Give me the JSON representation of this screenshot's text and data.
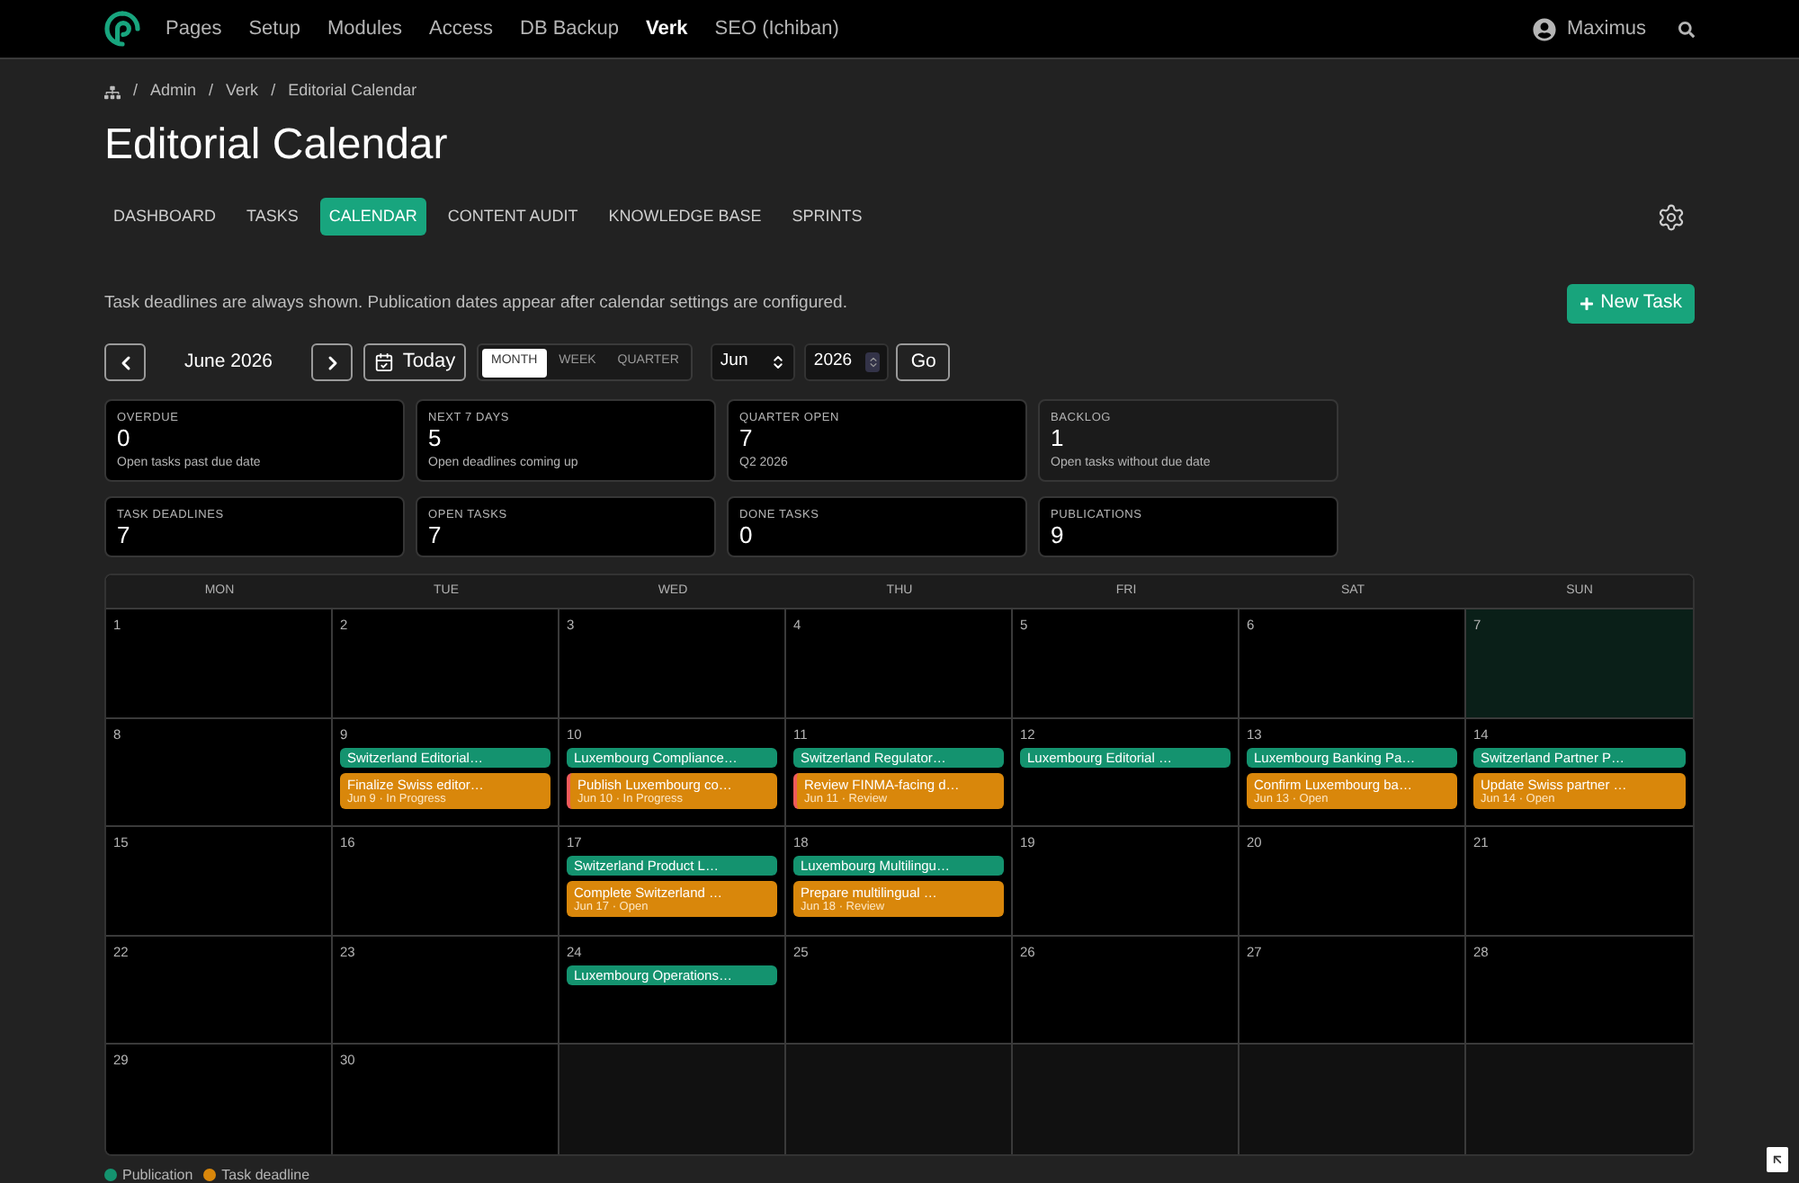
{
  "nav": {
    "links": [
      {
        "label": "Pages",
        "selected": false
      },
      {
        "label": "Setup",
        "selected": false
      },
      {
        "label": "Modules",
        "selected": false
      },
      {
        "label": "Access",
        "selected": false
      },
      {
        "label": "DB Backup",
        "selected": false
      },
      {
        "label": "Verk",
        "selected": true
      },
      {
        "label": "SEO (Ichiban)",
        "selected": false
      }
    ],
    "user": "Maximus"
  },
  "breadcrumb": [
    {
      "separator": "/",
      "label": "Admin"
    },
    {
      "separator": "/",
      "label": "Verk"
    },
    {
      "separator": "/",
      "label": "Editorial Calendar"
    }
  ],
  "title": "Editorial Calendar",
  "tabs": [
    {
      "label": "DASHBOARD",
      "selected": false
    },
    {
      "label": "TASKS",
      "selected": false
    },
    {
      "label": "CALENDAR",
      "selected": true
    },
    {
      "label": "CONTENT AUDIT",
      "selected": false
    },
    {
      "label": "KNOWLEDGE BASE",
      "selected": false
    },
    {
      "label": "SPRINTS",
      "selected": false
    }
  ],
  "info": "Task deadlines are always shown. Publication dates appear after calendar settings are configured.",
  "new_task_button": "New Task",
  "controls": {
    "period": "June 2026",
    "today_button": "Today",
    "views": [
      {
        "label": "MONTH",
        "selected": true
      },
      {
        "label": "WEEK",
        "selected": false
      },
      {
        "label": "QUARTER",
        "selected": false
      }
    ],
    "month_select": "Jun",
    "year_input": "2026",
    "go_button": "Go"
  },
  "stats": [
    {
      "label": "OVERDUE",
      "value": "0",
      "note": "Open tasks past due date",
      "muted": false
    },
    {
      "label": "NEXT 7 DAYS",
      "value": "5",
      "note": "Open deadlines coming up",
      "muted": false
    },
    {
      "label": "QUARTER OPEN",
      "value": "7",
      "note": "Q2 2026",
      "muted": false
    },
    {
      "label": "BACKLOG",
      "value": "1",
      "note": "Open tasks without due date",
      "muted": true
    },
    {
      "label": "TASK DEADLINES",
      "value": "7",
      "muted": false
    },
    {
      "label": "OPEN TASKS",
      "value": "7",
      "muted": false
    },
    {
      "label": "DONE TASKS",
      "value": "0",
      "muted": false
    },
    {
      "label": "PUBLICATIONS",
      "value": "9",
      "muted": false
    }
  ],
  "calendar": {
    "weekdays": [
      "MON",
      "TUE",
      "WED",
      "THU",
      "FRI",
      "SAT",
      "SUN"
    ],
    "weeks": [
      [
        {
          "day": "1",
          "in_month": true,
          "today": false
        },
        {
          "day": "2",
          "in_month": true,
          "today": false
        },
        {
          "day": "3",
          "in_month": true,
          "today": false
        },
        {
          "day": "4",
          "in_month": true,
          "today": false
        },
        {
          "day": "5",
          "in_month": true,
          "today": false
        },
        {
          "day": "6",
          "in_month": true,
          "today": false
        },
        {
          "day": "7",
          "in_month": true,
          "today": true
        }
      ],
      [
        {
          "day": "8",
          "in_month": true,
          "today": false
        },
        {
          "day": "9",
          "in_month": true,
          "today": false,
          "events": [
            {
              "kind": "publication",
              "title": "Switzerland Editorial…"
            },
            {
              "kind": "task",
              "title": "Finalize Swiss editor…",
              "meta": "Jun 9 · In Progress",
              "flagged": false
            }
          ]
        },
        {
          "day": "10",
          "in_month": true,
          "today": false,
          "events": [
            {
              "kind": "publication",
              "title": "Luxembourg Compliance…"
            },
            {
              "kind": "task",
              "title": "Publish Luxembourg co…",
              "meta": "Jun 10 · In Progress",
              "flagged": true
            }
          ]
        },
        {
          "day": "11",
          "in_month": true,
          "today": false,
          "events": [
            {
              "kind": "publication",
              "title": "Switzerland Regulator…"
            },
            {
              "kind": "task",
              "title": "Review FINMA-facing d…",
              "meta": "Jun 11 · Review",
              "flagged": true
            }
          ]
        },
        {
          "day": "12",
          "in_month": true,
          "today": false,
          "events": [
            {
              "kind": "publication",
              "title": "Luxembourg Editorial …"
            }
          ]
        },
        {
          "day": "13",
          "in_month": true,
          "today": false,
          "events": [
            {
              "kind": "publication",
              "title": "Luxembourg Banking Pa…"
            },
            {
              "kind": "task",
              "title": "Confirm Luxembourg ba…",
              "meta": "Jun 13 · Open",
              "flagged": false
            }
          ]
        },
        {
          "day": "14",
          "in_month": true,
          "today": false,
          "events": [
            {
              "kind": "publication",
              "title": "Switzerland Partner P…"
            },
            {
              "kind": "task",
              "title": "Update Swiss partner …",
              "meta": "Jun 14 · Open",
              "flagged": false
            }
          ]
        }
      ],
      [
        {
          "day": "15",
          "in_month": true,
          "today": false
        },
        {
          "day": "16",
          "in_month": true,
          "today": false
        },
        {
          "day": "17",
          "in_month": true,
          "today": false,
          "events": [
            {
              "kind": "publication",
              "title": "Switzerland Product L…"
            },
            {
              "kind": "task",
              "title": "Complete Switzerland …",
              "meta": "Jun 17 · Open",
              "flagged": false
            }
          ]
        },
        {
          "day": "18",
          "in_month": true,
          "today": false,
          "events": [
            {
              "kind": "publication",
              "title": "Luxembourg Multilingu…"
            },
            {
              "kind": "task",
              "title": "Prepare multilingual …",
              "meta": "Jun 18 · Review",
              "flagged": false
            }
          ]
        },
        {
          "day": "19",
          "in_month": true,
          "today": false
        },
        {
          "day": "20",
          "in_month": true,
          "today": false
        },
        {
          "day": "21",
          "in_month": true,
          "today": false
        }
      ],
      [
        {
          "day": "22",
          "in_month": true,
          "today": false
        },
        {
          "day": "23",
          "in_month": true,
          "today": false
        },
        {
          "day": "24",
          "in_month": true,
          "today": false,
          "events": [
            {
              "kind": "publication",
              "title": "Luxembourg Operations…"
            }
          ]
        },
        {
          "day": "25",
          "in_month": true,
          "today": false
        },
        {
          "day": "26",
          "in_month": true,
          "today": false
        },
        {
          "day": "27",
          "in_month": true,
          "today": false
        },
        {
          "day": "28",
          "in_month": true,
          "today": false
        }
      ],
      [
        {
          "day": "29",
          "in_month": true,
          "today": false
        },
        {
          "day": "30",
          "in_month": true,
          "today": false
        },
        {
          "in_month": false
        },
        {
          "in_month": false
        },
        {
          "in_month": false
        },
        {
          "in_month": false
        },
        {
          "in_month": false
        }
      ]
    ]
  },
  "legend": [
    {
      "label": "Publication",
      "color": "#14936f"
    },
    {
      "label": "Task deadline",
      "color": "#d9870b"
    }
  ]
}
